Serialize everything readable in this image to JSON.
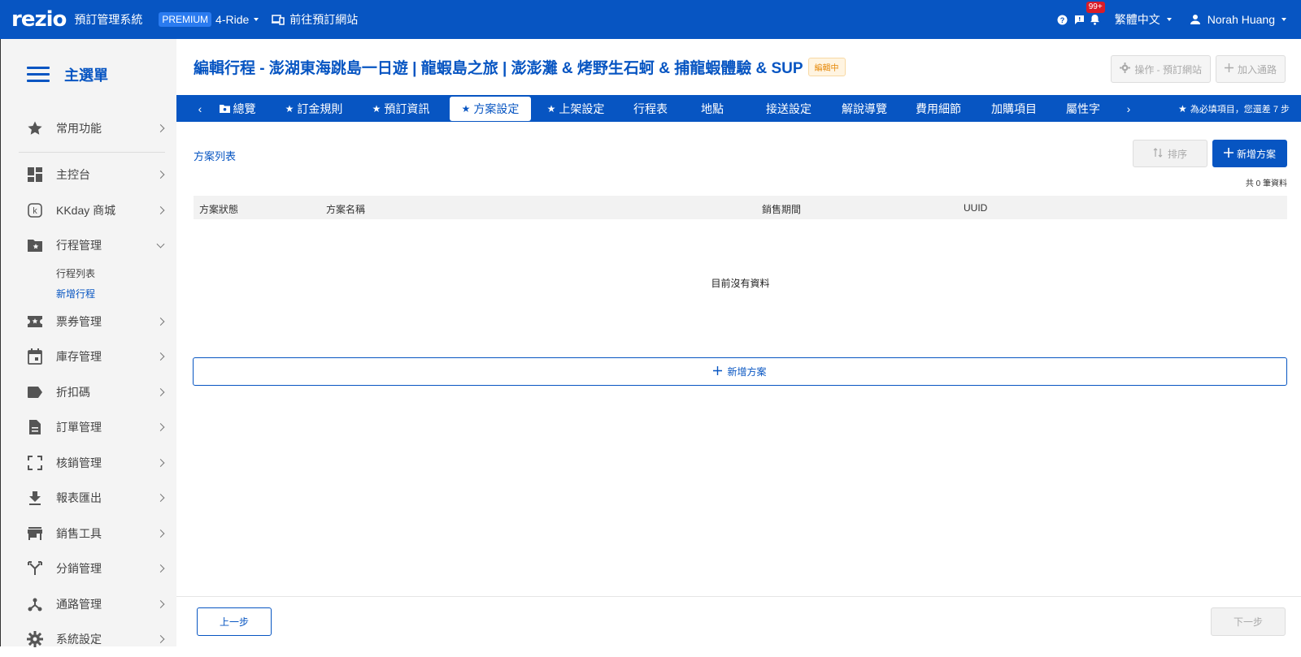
{
  "header": {
    "logo": "rezio",
    "system_name": "預訂管理系統",
    "plan": "PREMIUM",
    "company": "4-Ride",
    "goto_site": "前往預訂網站",
    "notification_count": "99+",
    "language": "繁體中文",
    "user_name": "Norah Huang"
  },
  "sidebar": {
    "title": "主選單",
    "favorites": {
      "label": "常用功能",
      "icon": "star-icon"
    },
    "items": [
      {
        "label": "主控台",
        "icon": "dashboard-icon"
      },
      {
        "label": "KKday 商城",
        "icon": "kkday-icon"
      },
      {
        "label": "行程管理",
        "icon": "folder-star-icon"
      },
      {
        "label": "票券管理",
        "icon": "ticket-icon"
      },
      {
        "label": "庫存管理",
        "icon": "calendar-icon"
      },
      {
        "label": "折扣碼",
        "icon": "tag-icon"
      },
      {
        "label": "訂單管理",
        "icon": "document-icon"
      },
      {
        "label": "核銷管理",
        "icon": "scan-icon"
      },
      {
        "label": "報表匯出",
        "icon": "download-icon"
      },
      {
        "label": "銷售工具",
        "icon": "store-icon"
      },
      {
        "label": "分銷管理",
        "icon": "split-icon"
      },
      {
        "label": "通路管理",
        "icon": "hub-icon"
      },
      {
        "label": "系統設定",
        "icon": "gear-icon"
      }
    ],
    "sub_items": [
      {
        "label": "行程列表",
        "active": false
      },
      {
        "label": "新增行程",
        "active": true
      }
    ]
  },
  "page": {
    "title": "編輯行程 - 澎湖東海跳島一日遊 | 龍蝦島之旅 | 澎澎灘 & 烤野生石蚵 & 捕龍蝦體驗 & SUP",
    "status": "編輯中",
    "action_settings": "操作 - 預訂網站",
    "action_add_channel": "加入通路"
  },
  "tabs": [
    {
      "label": "總覽",
      "icon": "folder",
      "active": false
    },
    {
      "label": "訂金規則",
      "icon": "star",
      "active": false
    },
    {
      "label": "預訂資訊",
      "icon": "star",
      "active": false
    },
    {
      "label": "方案設定",
      "icon": "star",
      "active": true
    },
    {
      "label": "上架設定",
      "icon": "star",
      "active": false
    },
    {
      "label": "行程表",
      "icon": "",
      "active": false
    },
    {
      "label": "地點",
      "icon": "",
      "active": false
    },
    {
      "label": "接送設定",
      "icon": "",
      "active": false
    },
    {
      "label": "解說導覽",
      "icon": "",
      "active": false
    },
    {
      "label": "費用細節",
      "icon": "",
      "active": false
    },
    {
      "label": "加購項目",
      "icon": "",
      "active": false
    },
    {
      "label": "屬性字",
      "icon": "",
      "active": false
    }
  ],
  "required_note": "為必填項目，您還差 7 步",
  "plans": {
    "section_title": "方案列表",
    "sort_label": "排序",
    "add_label": "新增方案",
    "count_text": "共 0 筆資料",
    "columns": [
      "方案狀態",
      "方案名稱",
      "銷售期間",
      "UUID"
    ],
    "rows": [],
    "empty_text": "目前沒有資料",
    "add_wide_label": "新增方案"
  },
  "footer": {
    "prev_label": "上一步",
    "next_label": "下一步"
  },
  "colors": {
    "primary": "#0755c2",
    "sidebar_bg": "#f4f4f4",
    "status_orange": "#e6890a",
    "badge_red": "#d81c28"
  }
}
